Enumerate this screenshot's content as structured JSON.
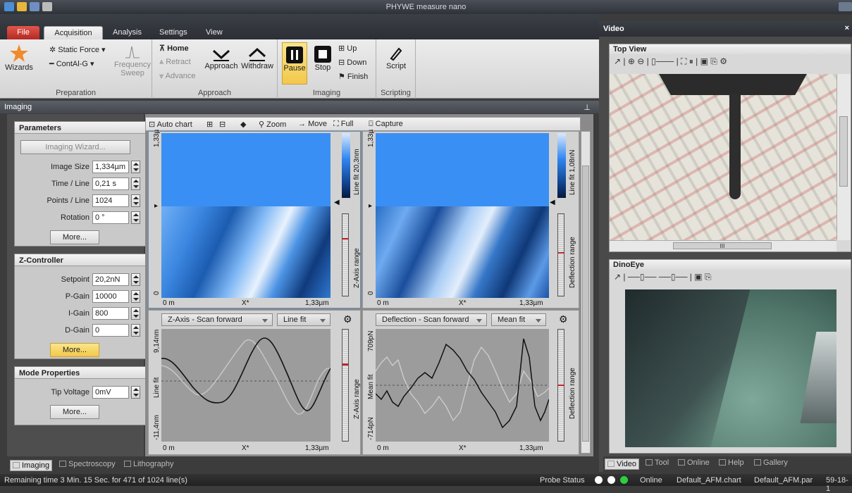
{
  "window": {
    "title": "PHYWE measure nano"
  },
  "ribbon_tabs": [
    "File",
    "Acquisition",
    "Analysis",
    "Settings",
    "View"
  ],
  "ribbon": {
    "wizards": "Wizards",
    "static_force": "Static Force",
    "contal": "ContAl-G",
    "frequency_sweep": "Frequency Sweep",
    "preparation": "Preparation",
    "home": "Home",
    "retract": "Retract",
    "advance": "Advance",
    "approach_btn": "Approach",
    "withdraw": "Withdraw",
    "approach_group": "Approach",
    "pause": "Pause",
    "stop": "Stop",
    "up": "Up",
    "down": "Down",
    "finish": "Finish",
    "imaging_group": "Imaging",
    "script": "Script",
    "scripting": "Scripting"
  },
  "imaging_panel": {
    "title": "Imaging"
  },
  "parameters": {
    "title": "Parameters",
    "wizard_btn": "Imaging Wizard...",
    "image_size_label": "Image Size",
    "image_size": "1,334µm",
    "time_line_label": "Time / Line",
    "time_line": "0,21 s",
    "points_line_label": "Points / Line",
    "points_line": "1024",
    "rotation_label": "Rotation",
    "rotation": "0 °",
    "more": "More..."
  },
  "zcontroller": {
    "title": "Z-Controller",
    "setpoint_label": "Setpoint",
    "setpoint": "20,2nN",
    "pgain_label": "P-Gain",
    "pgain": "10000",
    "igain_label": "I-Gain",
    "igain": "800",
    "dgain_label": "D-Gain",
    "dgain": "0",
    "more": "More..."
  },
  "mode": {
    "title": "Mode Properties",
    "tip_voltage_label": "Tip Voltage",
    "tip_voltage": "0mV",
    "more": "More..."
  },
  "chart_toolbar": {
    "auto_chart": "Auto chart",
    "zoom": "Zoom",
    "move": "Move",
    "full": "Full",
    "capture": "Capture"
  },
  "maps": {
    "left": {
      "y_top": "1,33µ",
      "y_zero": "0",
      "x0": "0 m",
      "xmid": "X*",
      "xmax": "1,33µm",
      "cbar_label": "Line fit 20,3nm",
      "range_label": "Z-Axis range"
    },
    "right": {
      "y_top": "1,33µ",
      "y_zero": "0",
      "x0": "0 m",
      "xmid": "X*",
      "xmax": "1,33µm",
      "cbar_label": "Line fit 1,08nN",
      "range_label": "Deflection range"
    }
  },
  "profiles": {
    "left": {
      "channel": "Z-Axis - Scan forward",
      "fit": "Line fit",
      "y_top": "9,14nm",
      "y_mid": "Line fit",
      "y_bot": "-11,4nm",
      "x0": "0 m",
      "xmid": "X*",
      "xmax": "1,33µm",
      "range_label": "Z-Axis range"
    },
    "right": {
      "channel": "Deflection - Scan forward",
      "fit": "Mean fit",
      "y_top": "709pN",
      "y_mid": "Mean fit",
      "y_bot": "-714pN",
      "x0": "0 m",
      "xmid": "X*",
      "xmax": "1,33µm",
      "range_label": "Deflection range"
    }
  },
  "video": {
    "title": "Video",
    "top_view": "Top View",
    "dinoeye": "DinoEye",
    "scroll_mark": "III"
  },
  "bottom_tabs": [
    "Imaging",
    "Spectroscopy",
    "Lithography"
  ],
  "video_tabs": [
    "Video",
    "Tool",
    "Online",
    "Help",
    "Gallery"
  ],
  "status": {
    "remaining": "Remaining time 3 Min. 15 Sec. for 471 of 1024 line(s)",
    "probe_status": "Probe Status",
    "online": "Online",
    "chart": "Default_AFM.chart",
    "par": "Default_AFM.par",
    "clock": "59-18-1"
  },
  "colors": {
    "accent": "#f2c84b",
    "file_tab": "#c9372c",
    "map_blue": "#2f86f0"
  }
}
